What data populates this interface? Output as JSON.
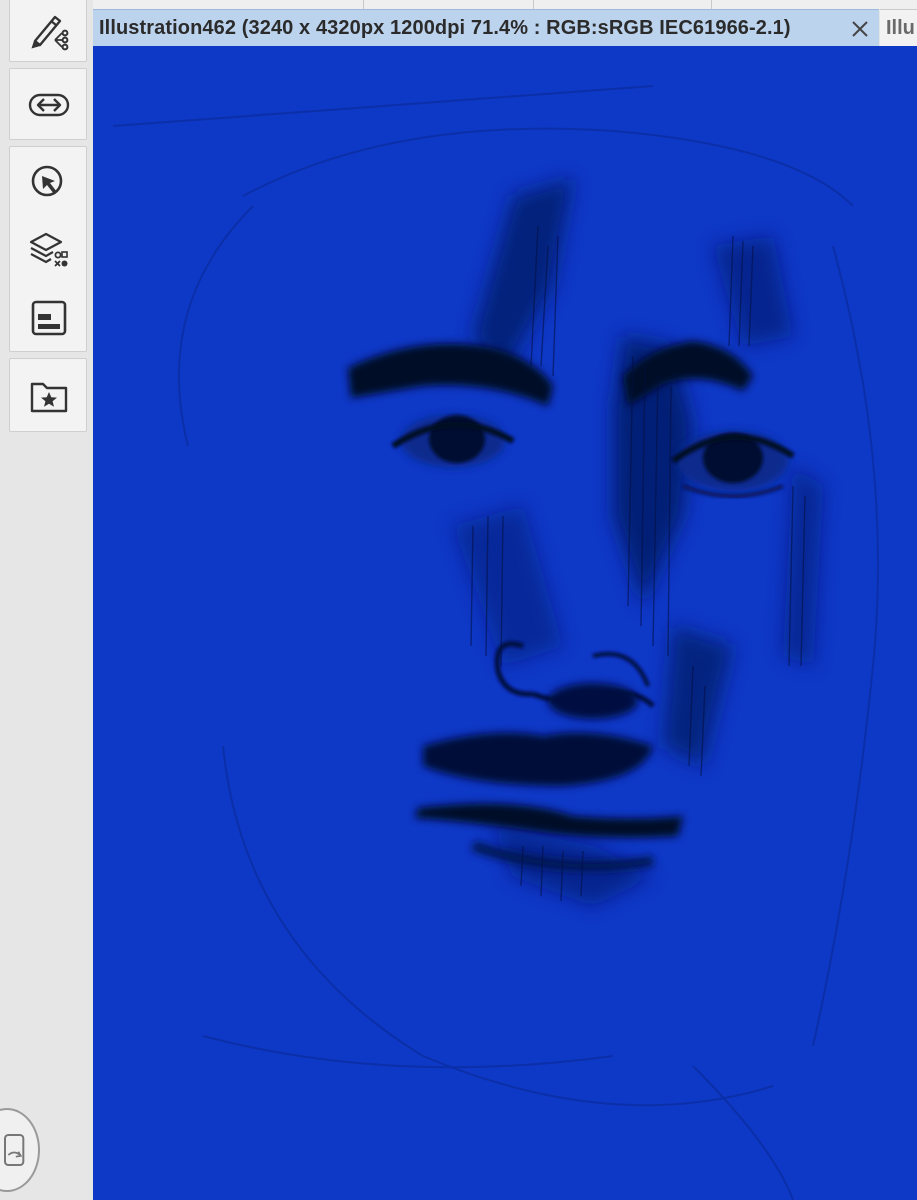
{
  "document": {
    "tab_title": "Illustration462 (3240 x 4320px 1200dpi 71.4% : RGB:sRGB IEC61966-2.1)",
    "next_tab_label": "Illu"
  },
  "toolbar": {
    "tools": [
      {
        "name": "pen-settings-icon"
      },
      {
        "name": "swap-icon"
      },
      {
        "name": "select-icon"
      },
      {
        "name": "layers-icon"
      },
      {
        "name": "panel-icon"
      },
      {
        "name": "favorites-icon"
      }
    ]
  },
  "canvas": {
    "background_color": "#0e38c6",
    "content": "pencil sketch of a face"
  },
  "colors": {
    "active_tab": "#bcd3ee",
    "toolbar_bg": "#e6e6e6"
  }
}
